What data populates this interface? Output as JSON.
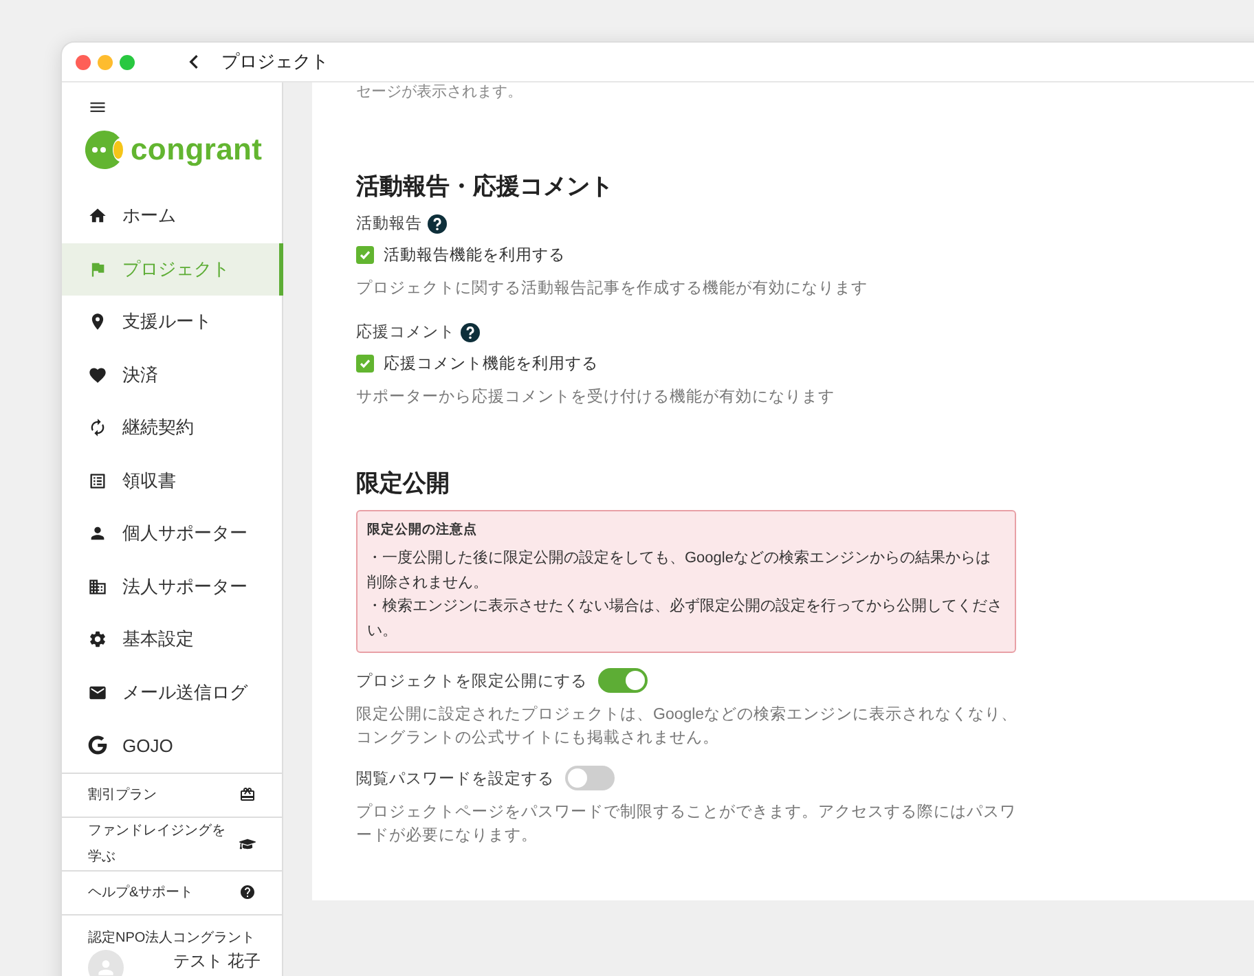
{
  "window": {
    "title": "プロジェクト"
  },
  "sidebar": {
    "logo_text": "congrant",
    "items": [
      {
        "label": "ホーム",
        "selected": false
      },
      {
        "label": "プロジェクト",
        "selected": true
      },
      {
        "label": "支援ルート",
        "selected": false
      },
      {
        "label": "決済",
        "selected": false
      },
      {
        "label": "継続契約",
        "selected": false
      },
      {
        "label": "領収書",
        "selected": false
      },
      {
        "label": "個人サポーター",
        "selected": false
      },
      {
        "label": "法人サポーター",
        "selected": false
      },
      {
        "label": "基本設定",
        "selected": false
      },
      {
        "label": "メール送信ログ",
        "selected": false
      },
      {
        "label": "GOJO",
        "selected": false
      }
    ],
    "footer_links": [
      {
        "label": "割引プラン"
      },
      {
        "label": "ファンドレイジングを学ぶ"
      },
      {
        "label": "ヘルプ&サポート"
      }
    ],
    "organization": "認定NPO法人コングラント",
    "user": "テスト 花子"
  },
  "main": {
    "top_text": "セージが表示されます。",
    "report_section": {
      "title": "活動報告・応援コメント",
      "fields": [
        {
          "label": "活動報告",
          "checkbox_label": "活動報告機能を利用する",
          "checked": true,
          "description": "プロジェクトに関する活動報告記事を作成する機能が有効になります"
        },
        {
          "label": "応援コメント",
          "checkbox_label": "応援コメント機能を利用する",
          "checked": true,
          "description": "サポーターから応援コメントを受け付ける機能が有効になります"
        }
      ]
    },
    "limited_section": {
      "title": "限定公開",
      "notice": {
        "title": "限定公開の注意点",
        "lines": [
          "・一度公開した後に限定公開の設定をしても、Googleなどの検索エンジンからの結果からは削除されません。",
          "・検索エンジンに表示させたくない場合は、必ず限定公開の設定を行ってから公開してください。"
        ]
      },
      "toggles": [
        {
          "label": "プロジェクトを限定公開にする",
          "on": true,
          "description": "限定公開に設定されたプロジェクトは、Googleなどの検索エンジンに表示されなくなり、コングラントの公式サイトにも掲載されません。"
        },
        {
          "label": "閲覧パスワードを設定する",
          "on": false,
          "description": "プロジェクトページをパスワードで制限することができます。アクセスする際にはパスワードが必要になります。"
        }
      ]
    }
  }
}
